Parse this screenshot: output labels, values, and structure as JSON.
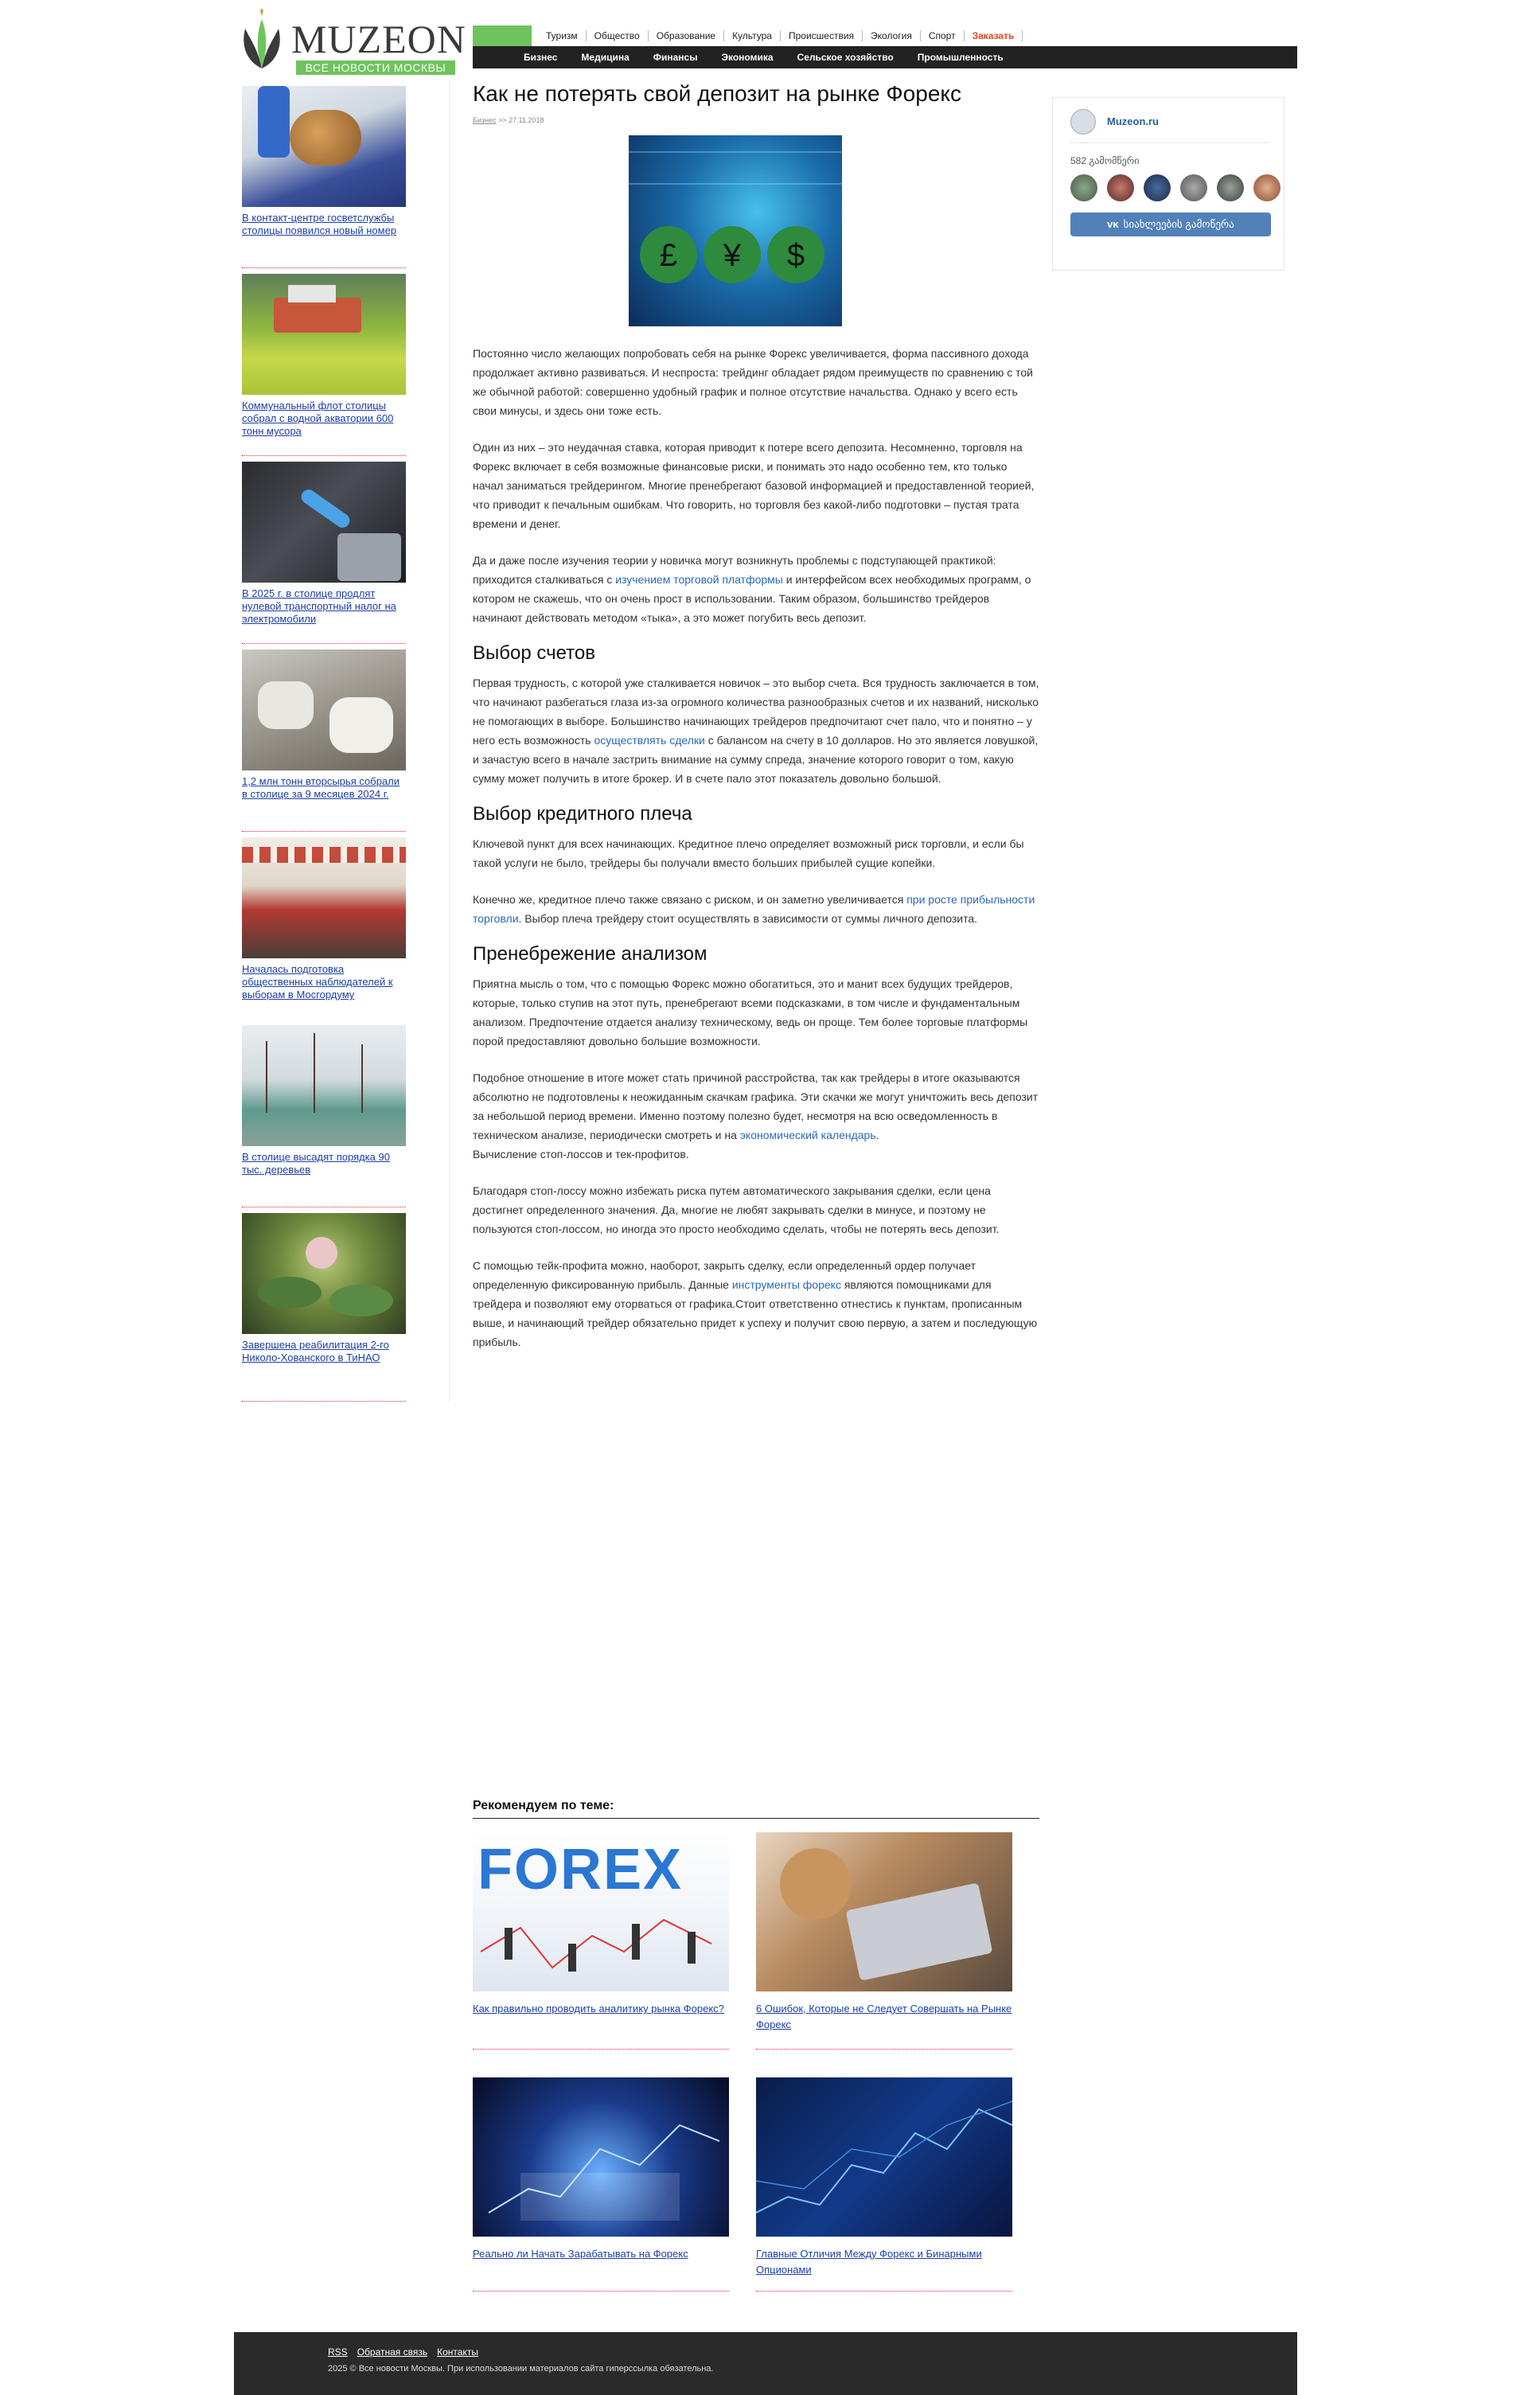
{
  "header": {
    "brand": "MUZEON",
    "tagline": "ВСЕ НОВОСТИ МОСКВЫ",
    "nav_top": [
      "Туризм",
      "Общество",
      "Образование",
      "Культура",
      "Происшествия",
      "Экология",
      "Спорт",
      "Заказать"
    ],
    "nav_bottom": [
      "Бизнес",
      "Медицина",
      "Финансы",
      "Экономика",
      "Сельское хозяйство",
      "Промышленность"
    ]
  },
  "sidebar": {
    "items": [
      {
        "caption": "В контакт-центре госветслужбы столицы появился новый номер"
      },
      {
        "caption": "Коммунальный флот столицы собрал с водной акватории 600 тонн мусора"
      },
      {
        "caption": "В 2025 г. в столице продлят нулевой транспортный налог на электромобили"
      },
      {
        "caption": "1,2 млн тонн вторсырья собрали в столице за 9 месяцев 2024 г."
      },
      {
        "caption": "Началась подготовка общественных наблюдателей к выборам в Мосгордуму"
      },
      {
        "caption": "В столице высадят порядка 90 тыс. деревьев"
      },
      {
        "caption": "Завершена реабилитация 2-го Николо-Хованского в ТиНАО"
      }
    ]
  },
  "article": {
    "title": "Как не потерять свой депозит на рынке Форекс",
    "category": "Бизнес",
    "date": ">> 27.11.2018",
    "p1": "Постоянно число желающих попробовать себя на рынке Форекс увеличивается, форма пассивного дохода продолжает активно развиваться. И неспроста: трейдинг обладает рядом преимуществ по сравнению с той же обычной работой: совершенно удобный график и полное отсутствие начальства. Однако у всего есть свои минусы, и здесь они тоже есть.",
    "p2": "Один из них – это неудачная ставка, которая приводит к потере всего депозита. Несомненно, торговля на Форекс включает в себя возможные финансовые риски, и понимать это надо особенно тем, кто только начал заниматься трейдерингом. Многие пренебрегают базовой информацией и предоставленной теорией, что приводит к печальным ошибкам. Что говорить, но торговля без какой-либо подготовки – пустая трата времени и денег.",
    "p3_a": "Да и даже после изучения теории у новичка могут возникнуть проблемы с подступающей практикой: приходится сталкиваться с ",
    "p3_link": "изучением торговой платформы",
    "p3_b": " и интерфейсом всех необходимых программ, о котором не скажешь, что он очень прост в использовании. Таким образом, большинство трейдеров начинают действовать методом «тыка», а это может погубить весь депозит.",
    "h2_1": "Выбор счетов",
    "p4_a": "Первая трудность, с которой уже сталкивается новичок – это выбор счета. Вся трудность заключается в том, что начинают разбегаться глаза из-за огромного количества разнообразных счетов и их названий, нисколько не помогающих в выборе. Большинство начинающих трейдеров предпочитают счет пало, что и понятно – у него есть возможность ",
    "p4_link": "осуществлять сделки",
    "p4_b": " с балансом на счету в 10 долларов. Но это является ловушкой, и зачастую всего в начале застрить внимание на сумму спреда, значение которого говорит о том, какую сумму может получить в итоге брокер. И в счете пало этот показатель довольно большой.",
    "h2_2": "Выбор кредитного плеча",
    "p5": "Ключевой пункт для всех начинающих. Кредитное плечо определяет возможный риск торговли, и если бы такой услуги не было, трейдеры бы получали вместо больших прибылей сущие копейки.",
    "p6_a": "Конечно же, кредитное плечо также связано с риском, и он заметно увеличивается ",
    "p6_link": "при росте прибыльности торговли",
    "p6_b": ". Выбор плеча трейдеру стоит осуществлять в зависимости от суммы личного депозита.",
    "h2_3": "Пренебрежение анализом",
    "p7": "Приятна мысль о том, что с помощью Форекс можно обогатиться, это и манит всех будущих трейдеров, которые, только ступив на этот путь, пренебрегают всеми подсказками, в том числе и фундаментальным анализом. Предпочтение отдается анализу техническому, ведь он проще. Тем более торговые платформы порой предоставляют довольно большие возможности.",
    "p8_a": "Подобное отношение в итоге может стать причиной расстройства, так как трейдеры в итоге оказываются абсолютно не подготовлены к неожиданным скачкам графика. Эти скачки же могут уничтожить весь депозит за небольшой период времени. Именно поэтому полезно будет, несмотря на всю осведомленность в техническом анализе, периодически смотреть и на ",
    "p8_link": "экономический календарь",
    "p8_b": ".",
    "p8_c": "Вычисление стоп-лоссов и тек-профитов.",
    "p9": "Благодаря стоп-лоссу можно избежать риска путем автоматического закрывания сделки, если цена достигнет определенного значения. Да, многие не любят закрывать сделки в минусе, и поэтому не пользуются стоп-лоссом, но иногда это просто необходимо сделать, чтобы не потерять весь депозит.",
    "p10_a": "С помощью тейк-профита можно, наоборот, закрыть сделку, если определенный ордер получает определенную фиксированную прибыль. Данные ",
    "p10_link": "инструменты форекс",
    "p10_b": " являются помощниками для трейдера и позволяют ему оторваться от графика.Стоит ответственно отнестись к пунктам, прописанным выше, и начинающий трейдер обязательно придет к успеху и получит свою первую, а затем и последующую прибыль."
  },
  "widget": {
    "name": "Muzeon.ru",
    "followers": "582 გამომწერი",
    "button": "სიახლეების გამოწერა"
  },
  "recommended": {
    "title": "Рекомендуем по теме:",
    "items": [
      {
        "caption": "Как правильно проводить аналитику рынка Форекс?"
      },
      {
        "caption": "6 Ошибок, Которые не Следует Совершать на Рынке Форекс"
      },
      {
        "caption": "Реально ли Начать Зарабатывать на Форекс"
      },
      {
        "caption": "Главные Отличия Между Форекс и Бинарными Опционами"
      }
    ],
    "forex_word": "FOREX"
  },
  "footer": {
    "links": [
      "RSS",
      "Обратная связь",
      "Контакты"
    ],
    "copyright": "2025 © Все новости Москвы. При использовании материалов сайта гиперссылка обязательна."
  }
}
